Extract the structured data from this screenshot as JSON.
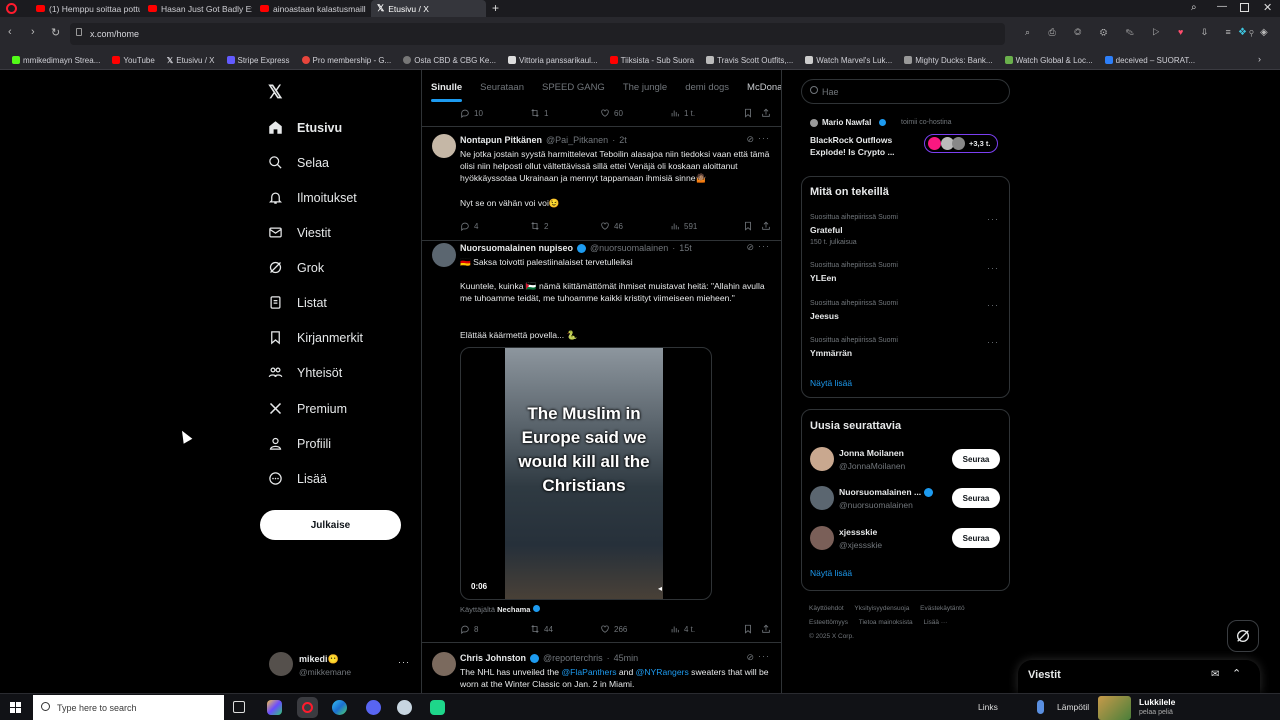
{
  "browser": {
    "tabs": [
      {
        "label": "(1) Hemppu soittaa pottu",
        "icon": "youtube-icon"
      },
      {
        "label": "Hasan Just Got Badly Exp",
        "icon": "youtube-icon"
      },
      {
        "label": "ainoastaan kalastusmaille",
        "icon": "youtube-icon"
      },
      {
        "label": "Etusivu / X",
        "icon": "x-icon"
      }
    ],
    "address": "x.com/home",
    "bookmarks": [
      "mmikedimayn Strea...",
      "YouTube",
      "Etusivu / X",
      "Stripe Express",
      "Pro membership - G...",
      "Osta CBD & CBG Ke...",
      "Vittoria panssarikaul...",
      "Tiiksista - Sub Suora",
      "Travis Scott Outfits,...",
      "Watch Marvel's Luk...",
      "Mighty Ducks: Bank...",
      "Watch Global & Loc...",
      "deceived – SUORAT..."
    ]
  },
  "nav": {
    "items": [
      {
        "label": "Etusivu",
        "icon": "home-icon"
      },
      {
        "label": "Selaa",
        "icon": "search-icon"
      },
      {
        "label": "Ilmoitukset",
        "icon": "bell-icon"
      },
      {
        "label": "Viestit",
        "icon": "mail-icon"
      },
      {
        "label": "Grok",
        "icon": "grok-icon"
      },
      {
        "label": "Listat",
        "icon": "list-icon"
      },
      {
        "label": "Kirjanmerkit",
        "icon": "bookmark-icon"
      },
      {
        "label": "Yhteisöt",
        "icon": "communities-icon"
      },
      {
        "label": "Premium",
        "icon": "x-icon"
      },
      {
        "label": "Profiili",
        "icon": "person-icon"
      },
      {
        "label": "Lisää",
        "icon": "more-circle-icon"
      }
    ],
    "post_button": "Julkaise",
    "profile": {
      "name": "mikedi😶",
      "handle": "@mikkemane"
    }
  },
  "timeline": {
    "tabs": [
      "Sinulle",
      "Seurataan",
      "SPEED GANG",
      "The jungle",
      "demi dogs",
      "McDonal"
    ],
    "top_actions": {
      "replies": "10",
      "reposts": "1",
      "likes": "60",
      "views": "1 t."
    },
    "tweets": [
      {
        "name": "Nontapun Pitkänen",
        "handle": "@Pai_Pitkanen",
        "time": "2t",
        "text": "Ne jotka jostain syystä harmittelevat Teboilin alasajoa niin tiedoksi vaan että tämä olisi niin helposti ollut vältettävissä sillä ettei Venäjä oli koskaan aloittanut hyökkäyssotaa Ukrainaan ja mennyt tappamaan ihmisiä sinne🤷🏽",
        "text2": "Nyt se on vähän voi voi😉",
        "replies": "4",
        "reposts": "2",
        "likes": "46",
        "views": "591"
      },
      {
        "name": "Nuorsuomalainen nupiseo",
        "handle": "@nuorsuomalainen",
        "time": "15t",
        "text": "🇩🇪 Saksa toivotti palestiinalaiset tervetulleiksi",
        "text2": "Kuuntele, kuinka 🇵🇸 nämä kiittämättömät ihmiset muistavat heitä: \"Allahin avulla me tuhoamme teidät, me tuhoamme kaikki kristityt viimeiseen mieheen.\"",
        "text3": "Elättää käärmettä povella... 🐍",
        "media_caption": "The Muslim in Europe said we would kill all the Christians",
        "media_time": "0:06",
        "attribution_prefix": "Käyttäjältä",
        "attribution_name": "Nechama",
        "replies": "8",
        "reposts": "44",
        "likes": "266",
        "views": "4 t."
      },
      {
        "name": "Chris Johnston",
        "handle": "@reporterchris",
        "time": "45min",
        "text_a": "The NHL has unveiled the ",
        "mention1": "@FlaPanthers",
        "text_b": " and ",
        "mention2": "@NYRangers",
        "text_c": " sweaters that will be worn at the Winter Classic on Jan. 2 in Miami."
      }
    ]
  },
  "right": {
    "search_placeholder": "Hae",
    "live": {
      "host": "Mario Nawfal",
      "host_role": "toimii co-hostina",
      "title": "BlackRock Outflows Explode! Is Crypto ...",
      "listeners": "+3,3 t."
    },
    "trends_title": "Mitä on tekeillä",
    "trends": [
      {
        "context": "Suosittua aihepiirissä Suomi",
        "name": "Grateful",
        "count": "150 t. julkaisua"
      },
      {
        "context": "Suosittua aihepiirissä Suomi",
        "name": "YLEen",
        "count": ""
      },
      {
        "context": "Suosittua aihepiirissä Suomi",
        "name": "Jeesus",
        "count": ""
      },
      {
        "context": "Suosittua aihepiirissä Suomi",
        "name": "Ymmärrän",
        "count": ""
      }
    ],
    "show_more": "Näytä lisää",
    "wtf_title": "Uusia seurattavia",
    "wtf": [
      {
        "name": "Jonna Moilanen",
        "handle": "@JonnaMoilanen",
        "verified": false
      },
      {
        "name": "Nuorsuomalainen ...",
        "handle": "@nuorsuomalainen",
        "verified": true
      },
      {
        "name": "xjessskie",
        "handle": "@xjessskie",
        "verified": false
      }
    ],
    "follow_label": "Seuraa",
    "show_more2": "Näytä lisää",
    "footer": [
      "Käyttöehdot",
      "Yksityisyydensuoja",
      "Evästekäytäntö",
      "Esteettömyys",
      "Tietoa mainoksista",
      "Lisää ···",
      "© 2025 X Corp."
    ]
  },
  "drawer": {
    "title": "Viestit"
  },
  "taskbar": {
    "search_placeholder": "Type here to search",
    "links": "Links",
    "weather": "Lämpötil",
    "game_title": "Lukkilele",
    "game_sub": "pelaa peliä"
  },
  "colors": {
    "accent": "#1d9bf0",
    "background": "#000000",
    "border": "#2f3336",
    "muted": "#71767b"
  }
}
